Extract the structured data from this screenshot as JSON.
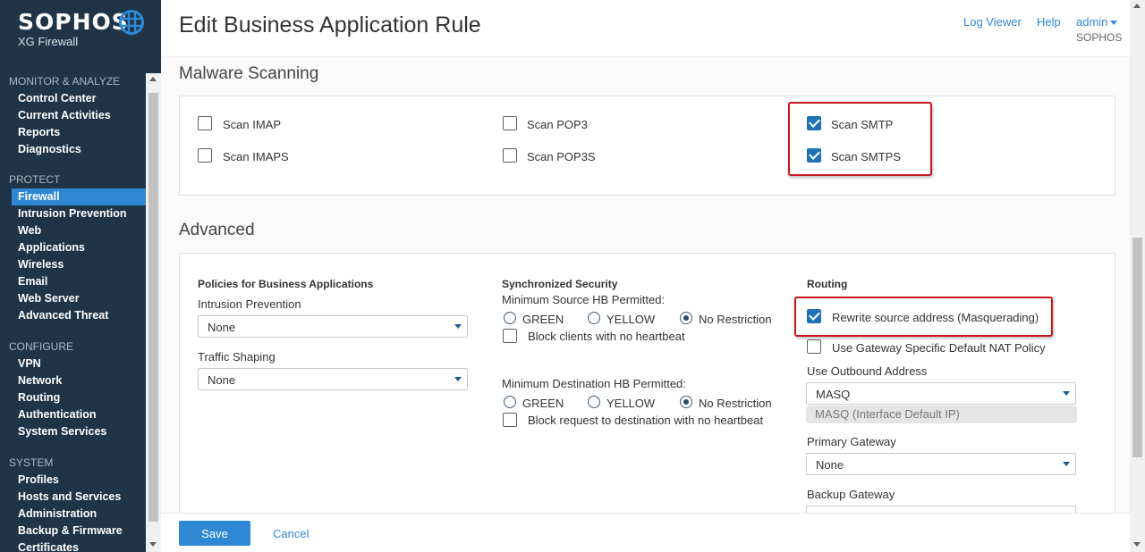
{
  "brand": {
    "logo": "SOPHOS",
    "product": "XG Firewall"
  },
  "nav": {
    "sections": [
      {
        "title": "MONITOR & ANALYZE",
        "items": [
          "Control Center",
          "Current Activities",
          "Reports",
          "Diagnostics"
        ]
      },
      {
        "title": "PROTECT",
        "items": [
          "Firewall",
          "Intrusion Prevention",
          "Web",
          "Applications",
          "Wireless",
          "Email",
          "Web Server",
          "Advanced Threat"
        ]
      },
      {
        "title": "CONFIGURE",
        "items": [
          "VPN",
          "Network",
          "Routing",
          "Authentication",
          "System Services"
        ]
      },
      {
        "title": "SYSTEM",
        "items": [
          "Profiles",
          "Hosts and Services",
          "Administration",
          "Backup & Firmware",
          "Certificates"
        ]
      }
    ],
    "active": "Firewall"
  },
  "header": {
    "title": "Edit Business Application Rule",
    "log_viewer": "Log Viewer",
    "help": "Help",
    "user": "admin",
    "org": "SOPHOS"
  },
  "malware": {
    "title": "Malware Scanning",
    "scan_imap": {
      "label": "Scan IMAP",
      "checked": false
    },
    "scan_imaps": {
      "label": "Scan IMAPS",
      "checked": false
    },
    "scan_pop3": {
      "label": "Scan POP3",
      "checked": false
    },
    "scan_pop3s": {
      "label": "Scan POP3S",
      "checked": false
    },
    "scan_smtp": {
      "label": "Scan SMTP",
      "checked": true
    },
    "scan_smtps": {
      "label": "Scan SMTPS",
      "checked": true
    }
  },
  "advanced": {
    "title": "Advanced",
    "policies": {
      "heading": "Policies for Business Applications",
      "ips_label": "Intrusion Prevention",
      "ips_value": "None",
      "shaping_label": "Traffic Shaping",
      "shaping_value": "None"
    },
    "sync": {
      "heading": "Synchronized Security",
      "min_source_label": "Minimum Source HB Permitted:",
      "min_dest_label": "Minimum Destination HB Permitted:",
      "opt_green": "GREEN",
      "opt_yellow": "YELLOW",
      "opt_none": "No Restriction",
      "source_selected": "No Restriction",
      "dest_selected": "No Restriction",
      "block_clients": "Block clients with no heartbeat",
      "block_request": "Block request to destination with no heartbeat"
    },
    "routing": {
      "heading": "Routing",
      "rewrite": "Rewrite source address (Masquerading)",
      "rewrite_checked": true,
      "gateway_nat": "Use Gateway Specific Default NAT Policy",
      "gateway_nat_checked": false,
      "outbound_label": "Use Outbound Address",
      "outbound_value": "MASQ",
      "outbound_hint": "MASQ (Interface Default IP)",
      "primary_label": "Primary Gateway",
      "primary_value": "None",
      "backup_label": "Backup Gateway"
    }
  },
  "footer": {
    "save": "Save",
    "cancel": "Cancel"
  },
  "colors": {
    "sidebar": "#1f3447",
    "accent": "#2f88d4",
    "highlight": "#c8171b"
  }
}
